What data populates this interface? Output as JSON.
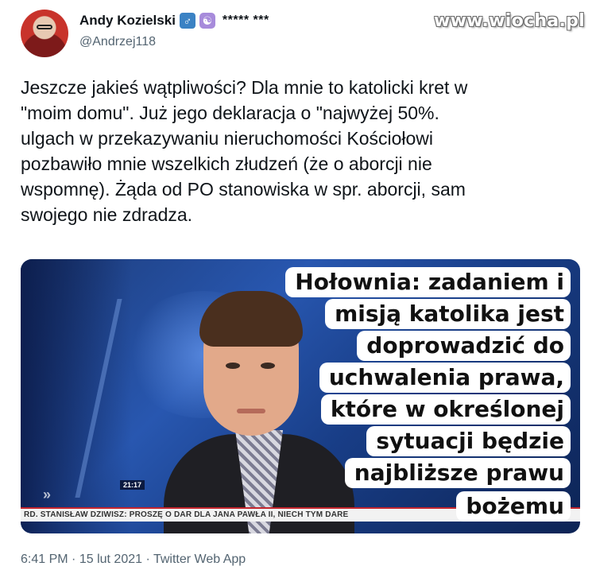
{
  "author": {
    "display_name": "Andy Kozielski",
    "badges": [
      "male-sign-icon",
      "yin-yang-icon"
    ],
    "stars": "***** ***",
    "handle": "@Andrzej118"
  },
  "watermark": "www.wiocha.pl",
  "tweet": {
    "lines": [
      "Jeszcze jakieś wątpliwości? Dla mnie to katolicki kret w",
      "\"moim domu\". Już jego deklaracja o \"najwyżej 50%.",
      "ulgach w przekazywaniu nieruchomości Kościołowi",
      "pozbawiło mnie wszelkich złudzeń (że o aborcji nie",
      "wspomnę). Żąda od PO stanowiska w spr. aborcji, sam",
      "swojego nie zdradza."
    ]
  },
  "media": {
    "caption_lines": [
      "Hołownia: zadaniem i",
      "misją katolika jest",
      "doprowadzić do",
      "uchwalenia prawa,",
      "które w określonej",
      "sytuacji będzie",
      "najbliższe prawu",
      "bożemu"
    ],
    "tv_clock": "21:17",
    "ticker": "RD. STANISŁAW DZIWISZ: PROSZĘ O DAR DLA JANA PAWŁA II, NIECH TYM DARE"
  },
  "meta": {
    "time": "6:41 PM",
    "separator": "·",
    "date": "15 lut 2021",
    "source": "Twitter Web App"
  }
}
